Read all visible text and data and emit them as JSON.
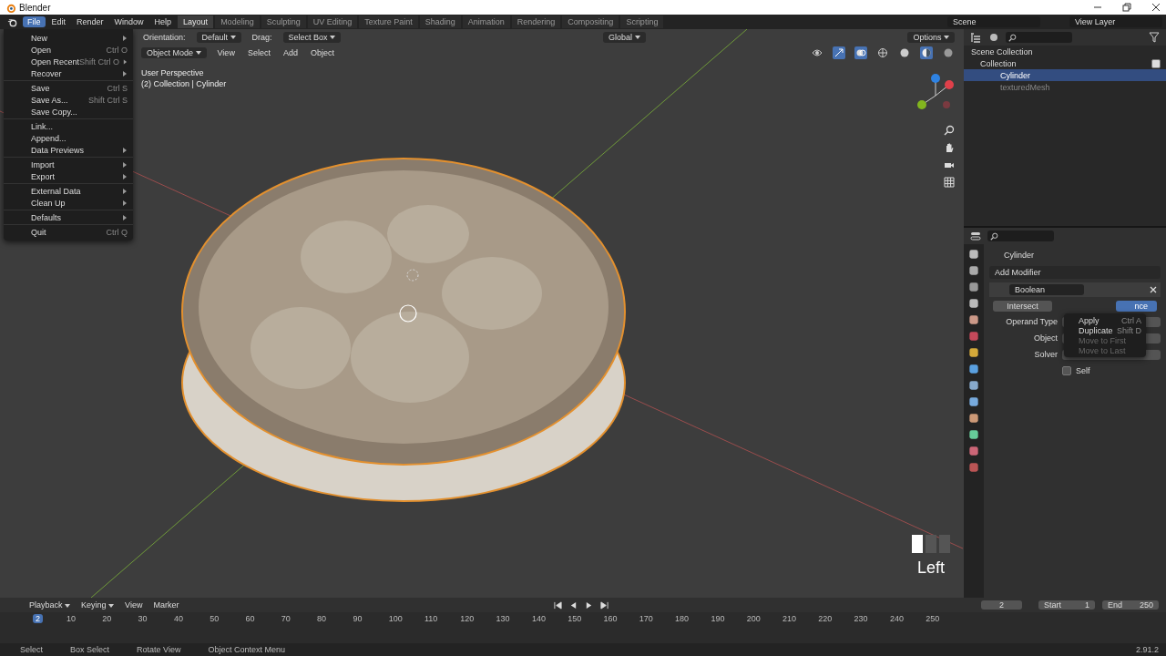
{
  "window": {
    "title": "Blender"
  },
  "menubar": [
    {
      "label": "File",
      "selected": true
    },
    {
      "label": "Edit",
      "selected": false
    },
    {
      "label": "Render",
      "selected": false
    },
    {
      "label": "Window",
      "selected": false
    },
    {
      "label": "Help",
      "selected": false
    }
  ],
  "workspaces": [
    {
      "label": "Layout",
      "selected": true
    },
    {
      "label": "Modeling",
      "selected": false
    },
    {
      "label": "Sculpting",
      "selected": false
    },
    {
      "label": "UV Editing",
      "selected": false
    },
    {
      "label": "Texture Paint",
      "selected": false
    },
    {
      "label": "Shading",
      "selected": false
    },
    {
      "label": "Animation",
      "selected": false
    },
    {
      "label": "Rendering",
      "selected": false
    },
    {
      "label": "Compositing",
      "selected": false
    },
    {
      "label": "Scripting",
      "selected": false
    }
  ],
  "scene": "Scene",
  "view_layer": "View Layer",
  "viewport": {
    "orientation_label": "Orientation:",
    "orientation": "Default",
    "drag_label": "Drag:",
    "drag": "Select Box",
    "transform": "Global",
    "options": "Options",
    "mode": "Object Mode",
    "menus": [
      "View",
      "Select",
      "Add",
      "Object"
    ],
    "overlay": [
      "User Perspective",
      "(2) Collection | Cylinder"
    ],
    "key_display": "Left"
  },
  "file_menu": [
    [
      {
        "label": "New",
        "submenu": true
      },
      {
        "label": "Open",
        "shortcut": "Ctrl O",
        "submenu": false
      },
      {
        "label": "Open Recent",
        "shortcut": "Shift Ctrl O",
        "submenu": true
      },
      {
        "label": "Recover",
        "submenu": true
      }
    ],
    [
      {
        "label": "Save",
        "shortcut": "Ctrl S",
        "submenu": false
      },
      {
        "label": "Save As...",
        "shortcut": "Shift Ctrl S",
        "submenu": false
      },
      {
        "label": "Save Copy...",
        "submenu": false
      }
    ],
    [
      {
        "label": "Link...",
        "submenu": false
      },
      {
        "label": "Append...",
        "submenu": false
      },
      {
        "label": "Data Previews",
        "submenu": true
      }
    ],
    [
      {
        "label": "Import",
        "submenu": true
      },
      {
        "label": "Export",
        "submenu": true
      }
    ],
    [
      {
        "label": "External Data",
        "submenu": true
      },
      {
        "label": "Clean Up",
        "submenu": true
      }
    ],
    [
      {
        "label": "Defaults",
        "submenu": true
      }
    ],
    [
      {
        "label": "Quit",
        "shortcut": "Ctrl Q",
        "submenu": false
      }
    ]
  ],
  "outliner": [
    {
      "label": "Scene Collection",
      "selected": false,
      "children": [
        {
          "label": "Collection",
          "selected": false,
          "checked": true,
          "children": [
            {
              "label": "Cylinder",
              "selected": true
            },
            {
              "label": "texturedMesh",
              "selected": false
            }
          ]
        }
      ]
    }
  ],
  "properties": {
    "object": "Cylinder",
    "add_modifier": "Add Modifier",
    "modifier": {
      "name": "Boolean",
      "operations": [
        {
          "label": "Intersect",
          "selected": false
        },
        {
          "label": "nce",
          "selected": true
        }
      ],
      "field_labels": [
        "Operand Type",
        "Object",
        "Solver"
      ],
      "self": {
        "label": "Self",
        "checked": false
      }
    },
    "context_menu": [
      {
        "label": "Apply",
        "shortcut": "Ctrl A",
        "disabled": false
      },
      {
        "label": "Duplicate",
        "shortcut": "Shift D",
        "disabled": false
      },
      {
        "label": "Move to First",
        "disabled": true
      },
      {
        "label": "Move to Last",
        "disabled": true
      }
    ]
  },
  "timeline": {
    "menus": [
      {
        "label": "Playback",
        "dropdown": true
      },
      {
        "label": "Keying",
        "dropdown": true
      },
      {
        "label": "View",
        "dropdown": false
      },
      {
        "label": "Marker",
        "dropdown": false
      }
    ],
    "current_frame": "2",
    "frame_marker": "2",
    "start_label": "Start",
    "start": "1",
    "end_label": "End",
    "end": "250",
    "ticks": [
      "10",
      "20",
      "30",
      "40",
      "50",
      "60",
      "70",
      "80",
      "90",
      "100",
      "110",
      "120",
      "130",
      "140",
      "150",
      "160",
      "170",
      "180",
      "190",
      "200",
      "210",
      "220",
      "230",
      "240",
      "250"
    ]
  },
  "status_bar": {
    "items": [
      "Select",
      "Box Select",
      "Rotate View",
      "Object Context Menu"
    ],
    "version": "2.91.2"
  }
}
